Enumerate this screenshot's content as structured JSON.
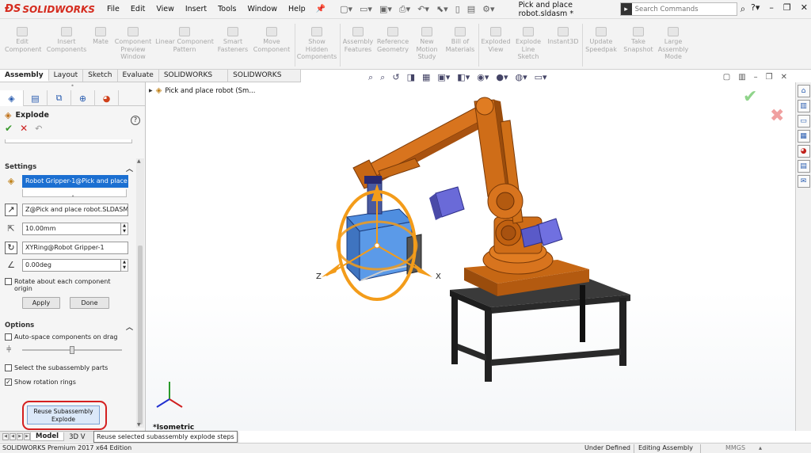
{
  "app": {
    "brand": "SOLIDWORKS",
    "doc_title": "Pick and place robot.sldasm *"
  },
  "menu": [
    "File",
    "Edit",
    "View",
    "Insert",
    "Tools",
    "Window",
    "Help"
  ],
  "search": {
    "placeholder": "Search Commands"
  },
  "ribbon": [
    "Edit\nComponent",
    "Insert\nComponents",
    "Mate",
    "Component\nPreview\nWindow",
    "Linear Component\nPattern",
    "Smart\nFasteners",
    "Move\nComponent",
    "Show\nHidden\nComponents",
    "Assembly\nFeatures",
    "Reference\nGeometry",
    "New\nMotion\nStudy",
    "Bill of\nMaterials",
    "Exploded\nView",
    "Explode\nLine\nSketch",
    "Instant3D",
    "Update\nSpeedpak",
    "Take\nSnapshot",
    "Large\nAssembly\nMode"
  ],
  "cmd_tabs": [
    "Assembly",
    "Layout",
    "Sketch",
    "Evaluate",
    "SOLIDWORKS Add-Ins",
    "SOLIDWORKS Visualize"
  ],
  "panel": {
    "title": "Explode",
    "settings_label": "Settings",
    "component": "Robot Gripper-1@Pick and place",
    "direction": "Z@Pick and place robot.SLDASM",
    "distance": "10.00mm",
    "rotation_axis": "XYRing@Robot Gripper-1",
    "angle": "0.00deg",
    "rotate_each": "Rotate about each component origin",
    "apply": "Apply",
    "done": "Done",
    "options_label": "Options",
    "auto_space": "Auto-space components on drag",
    "select_sub": "Select the subassembly parts",
    "show_rings": "Show rotation rings",
    "show_rings_checked": true,
    "reuse_line1": "Reuse Subassembly",
    "reuse_line2": "Explode"
  },
  "tree": {
    "root": "Pick and place robot  (Sm..."
  },
  "viewport": {
    "view_name": "*Isometric",
    "triad_x": "X",
    "triad_z": "Z"
  },
  "bottom_tabs": [
    "Model",
    "3D V"
  ],
  "tooltip": "Reuse selected subassembly explode steps",
  "status": {
    "edition": "SOLIDWORKS Premium 2017 x64 Edition",
    "state": "Under Defined",
    "mode": "Editing Assembly",
    "units": "MMGS"
  },
  "colors": {
    "robot_orange": "#d8741e",
    "robot_dark": "#9a4c0c",
    "motor_blue": "#6a6ad8",
    "gripper_blue": "#4f8ee0",
    "stand_black": "#222222",
    "ring_orange": "#f39c1a",
    "highlight_red": "#d42020"
  }
}
